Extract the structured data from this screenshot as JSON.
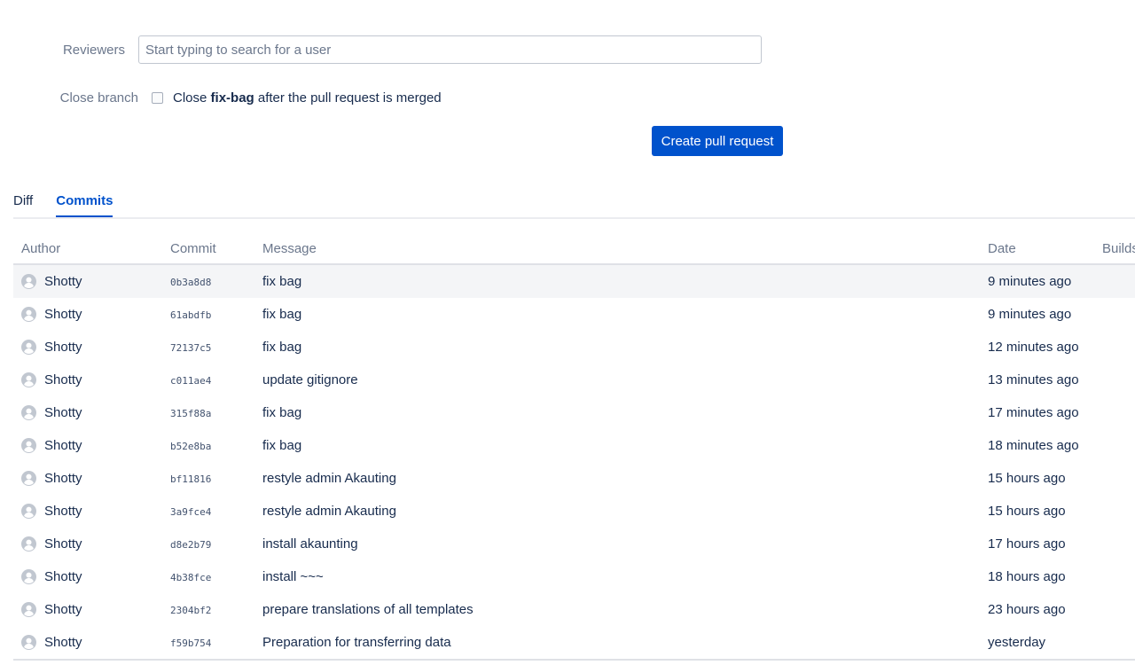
{
  "form": {
    "reviewers_label": "Reviewers",
    "reviewers_placeholder": "Start typing to search for a user",
    "close_branch_label": "Close branch",
    "close_text_before": "Close ",
    "close_branch_name": "fix-bag",
    "close_text_after": " after the pull request is merged",
    "create_button_label": "Create pull request"
  },
  "colors": {
    "primary": "#0052cc",
    "text": "#172b4d",
    "muted": "#6b778c"
  },
  "tabs": [
    {
      "label": "Diff",
      "active": false
    },
    {
      "label": "Commits",
      "active": true
    }
  ],
  "table": {
    "headers": {
      "author": "Author",
      "commit": "Commit",
      "message": "Message",
      "date": "Date",
      "builds": "Builds"
    },
    "rows": [
      {
        "author": "Shotty",
        "commit": "0b3a8d8",
        "message": "fix bag",
        "date": "9 minutes ago"
      },
      {
        "author": "Shotty",
        "commit": "61abdfb",
        "message": "fix bag",
        "date": "9 minutes ago"
      },
      {
        "author": "Shotty",
        "commit": "72137c5",
        "message": "fix bag",
        "date": "12 minutes ago"
      },
      {
        "author": "Shotty",
        "commit": "c011ae4",
        "message": "update gitignore",
        "date": "13 minutes ago"
      },
      {
        "author": "Shotty",
        "commit": "315f88a",
        "message": "fix bag",
        "date": "17 minutes ago"
      },
      {
        "author": "Shotty",
        "commit": "b52e8ba",
        "message": "fix bag",
        "date": "18 minutes ago"
      },
      {
        "author": "Shotty",
        "commit": "bf11816",
        "message": "restyle admin Akauting",
        "date": "15 hours ago"
      },
      {
        "author": "Shotty",
        "commit": "3a9fce4",
        "message": "restyle admin Akauting",
        "date": "15 hours ago"
      },
      {
        "author": "Shotty",
        "commit": "d8e2b79",
        "message": "install akaunting",
        "date": "17 hours ago"
      },
      {
        "author": "Shotty",
        "commit": "4b38fce",
        "message": "install ~~~",
        "date": "18 hours ago"
      },
      {
        "author": "Shotty",
        "commit": "2304bf2",
        "message": "prepare translations of all templates",
        "date": "23 hours ago"
      },
      {
        "author": "Shotty",
        "commit": "f59b754",
        "message": "Preparation for transferring data",
        "date": "yesterday"
      }
    ]
  }
}
